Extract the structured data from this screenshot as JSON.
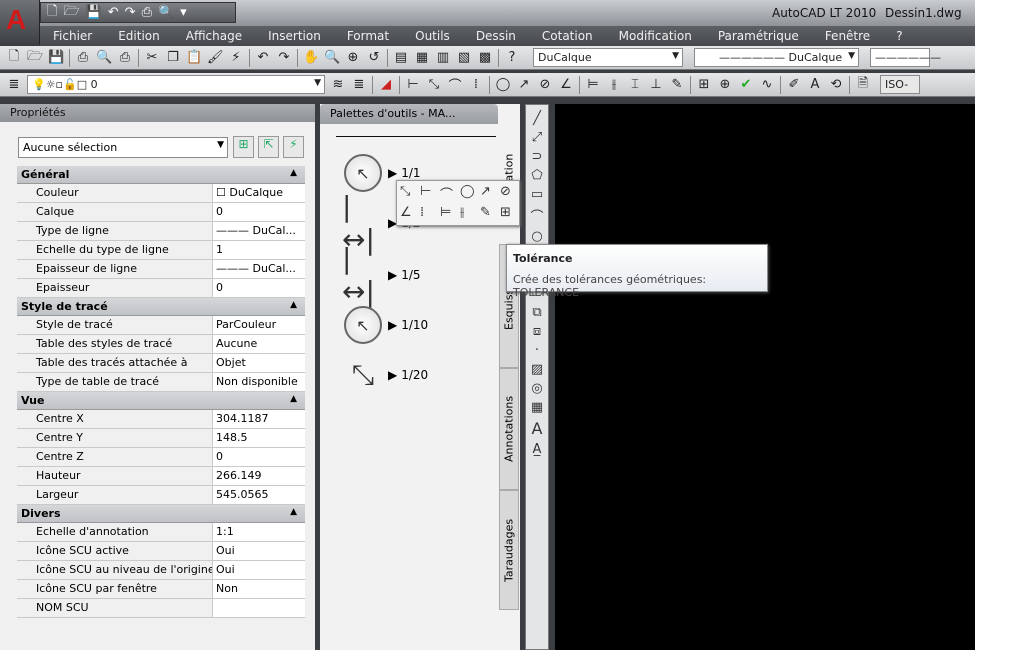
{
  "app": {
    "title": "AutoCAD LT 2010",
    "document": "Dessin1.dwg",
    "logo": "A"
  },
  "menu": [
    "Fichier",
    "Edition",
    "Affichage",
    "Insertion",
    "Format",
    "Outils",
    "Dessin",
    "Cotation",
    "Modification",
    "Paramétrique",
    "Fenêtre",
    "?"
  ],
  "toolbar": {
    "color_combo": "DuCalque",
    "linetype_combo": "DuCalque",
    "layer_combo": "0",
    "dimstyle": "ISO-"
  },
  "properties": {
    "title": "Propriétés",
    "selection": "Aucune sélection",
    "sections": [
      {
        "name": "Général",
        "rows": [
          [
            "Couleur",
            "☐ DuCalque"
          ],
          [
            "Calque",
            "0"
          ],
          [
            "Type de ligne",
            "——— DuCal..."
          ],
          [
            "Echelle du type de ligne",
            "1"
          ],
          [
            "Epaisseur de ligne",
            "——— DuCal..."
          ],
          [
            "Epaisseur",
            "0"
          ]
        ]
      },
      {
        "name": "Style de tracé",
        "rows": [
          [
            "Style de tracé",
            "ParCouleur"
          ],
          [
            "Table des styles de tracé",
            "Aucune"
          ],
          [
            "Table des tracés attachée à",
            "Objet"
          ],
          [
            "Type de table de tracé",
            "Non disponible"
          ]
        ]
      },
      {
        "name": "Vue",
        "rows": [
          [
            "Centre X",
            "304.1187"
          ],
          [
            "Centre Y",
            "148.5"
          ],
          [
            "Centre Z",
            "0"
          ],
          [
            "Hauteur",
            "266.149"
          ],
          [
            "Largeur",
            "545.0565"
          ]
        ]
      },
      {
        "name": "Divers",
        "rows": [
          [
            "Echelle d'annotation",
            "1:1"
          ],
          [
            "Icône SCU active",
            "Oui"
          ],
          [
            "Icône SCU au niveau de l'origine",
            "Oui"
          ],
          [
            "Icône SCU par fenêtre",
            "Non"
          ],
          [
            "NOM SCU",
            ""
          ]
        ]
      }
    ]
  },
  "palette": {
    "title": "Palettes d'outils - MA...",
    "tools": [
      "1/1",
      "1/2",
      "1/5",
      "1/10",
      "1/20"
    ],
    "tabs": [
      "Annotation",
      "Esquisse",
      "Annotations",
      "Taraudages"
    ]
  },
  "tooltip": {
    "title": "Tolérance",
    "text": "Crée des tolérances géométriques: TOLERANCE"
  }
}
